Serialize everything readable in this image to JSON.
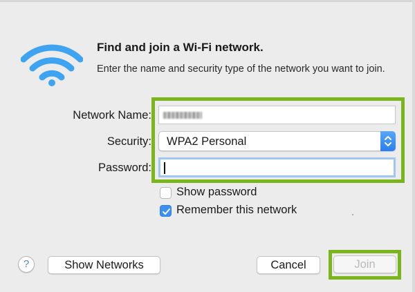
{
  "dialog": {
    "title": "Find and join a Wi-Fi network.",
    "subtitle": "Enter the name and security type of the network you want to join."
  },
  "form": {
    "network_name_label": "Network Name:",
    "network_name_value": "",
    "security_label": "Security:",
    "security_value": "WPA2 Personal",
    "password_label": "Password:",
    "password_value": ""
  },
  "options": {
    "show_password_label": "Show password",
    "show_password_checked": false,
    "remember_label": "Remember this network",
    "remember_checked": true
  },
  "buttons": {
    "help_label": "?",
    "show_networks_label": "Show Networks",
    "cancel_label": "Cancel",
    "join_label": "Join"
  },
  "icons": {
    "wifi": "wifi-icon",
    "stepper": "chevron-up-down-icon",
    "checkmark": "checkmark-icon"
  },
  "colors": {
    "highlight": "#7ab51d",
    "wifi_blue": "#3ea3f0",
    "accent": "#3d8ff5"
  }
}
